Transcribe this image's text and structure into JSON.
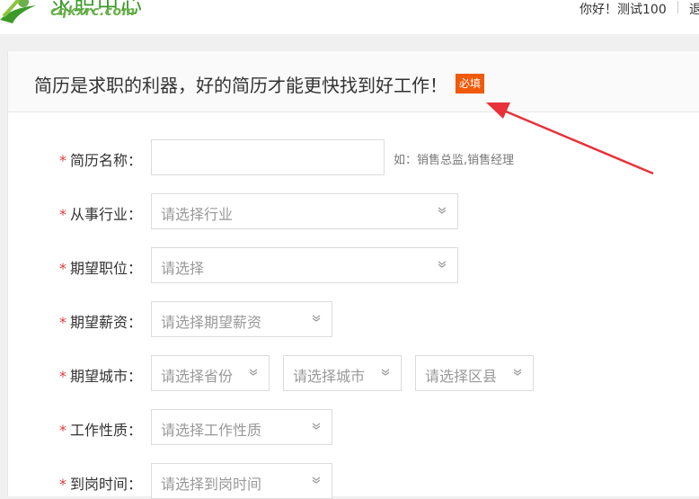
{
  "header": {
    "logo_cn": "求职中心",
    "logo_en": "cqkxrc.com",
    "greeting": "你好！测试100",
    "logout_partial": "退"
  },
  "panel": {
    "headline": "简历是求职的利器，好的简历才能更快找到好工作！",
    "required_badge": "必填"
  },
  "form": {
    "required_mark": "*",
    "resume_name": {
      "label": "简历名称：",
      "value": "",
      "hint": "如：销售总监,销售经理"
    },
    "industry": {
      "label": "从事行业：",
      "placeholder": "请选择行业"
    },
    "position": {
      "label": "期望职位：",
      "placeholder": "请选择"
    },
    "salary": {
      "label": "期望薪资：",
      "placeholder": "请选择期望薪资"
    },
    "city": {
      "label": "期望城市：",
      "province_placeholder": "请选择省份",
      "city_placeholder": "请选择城市",
      "district_placeholder": "请选择区县"
    },
    "job_nature": {
      "label": "工作性质：",
      "placeholder": "请选择工作性质"
    },
    "arrival_time": {
      "label": "到岗时间：",
      "placeholder": "请选择到岗时间"
    }
  },
  "colors": {
    "accent_orange": "#f05a0a",
    "required_red": "#e4393c",
    "annotation_arrow": "#e8313a",
    "brand_green": "#3d9a2a"
  },
  "icons": {
    "logo": "logo-mark-icon",
    "dropdown": "chevron-down-icon"
  }
}
